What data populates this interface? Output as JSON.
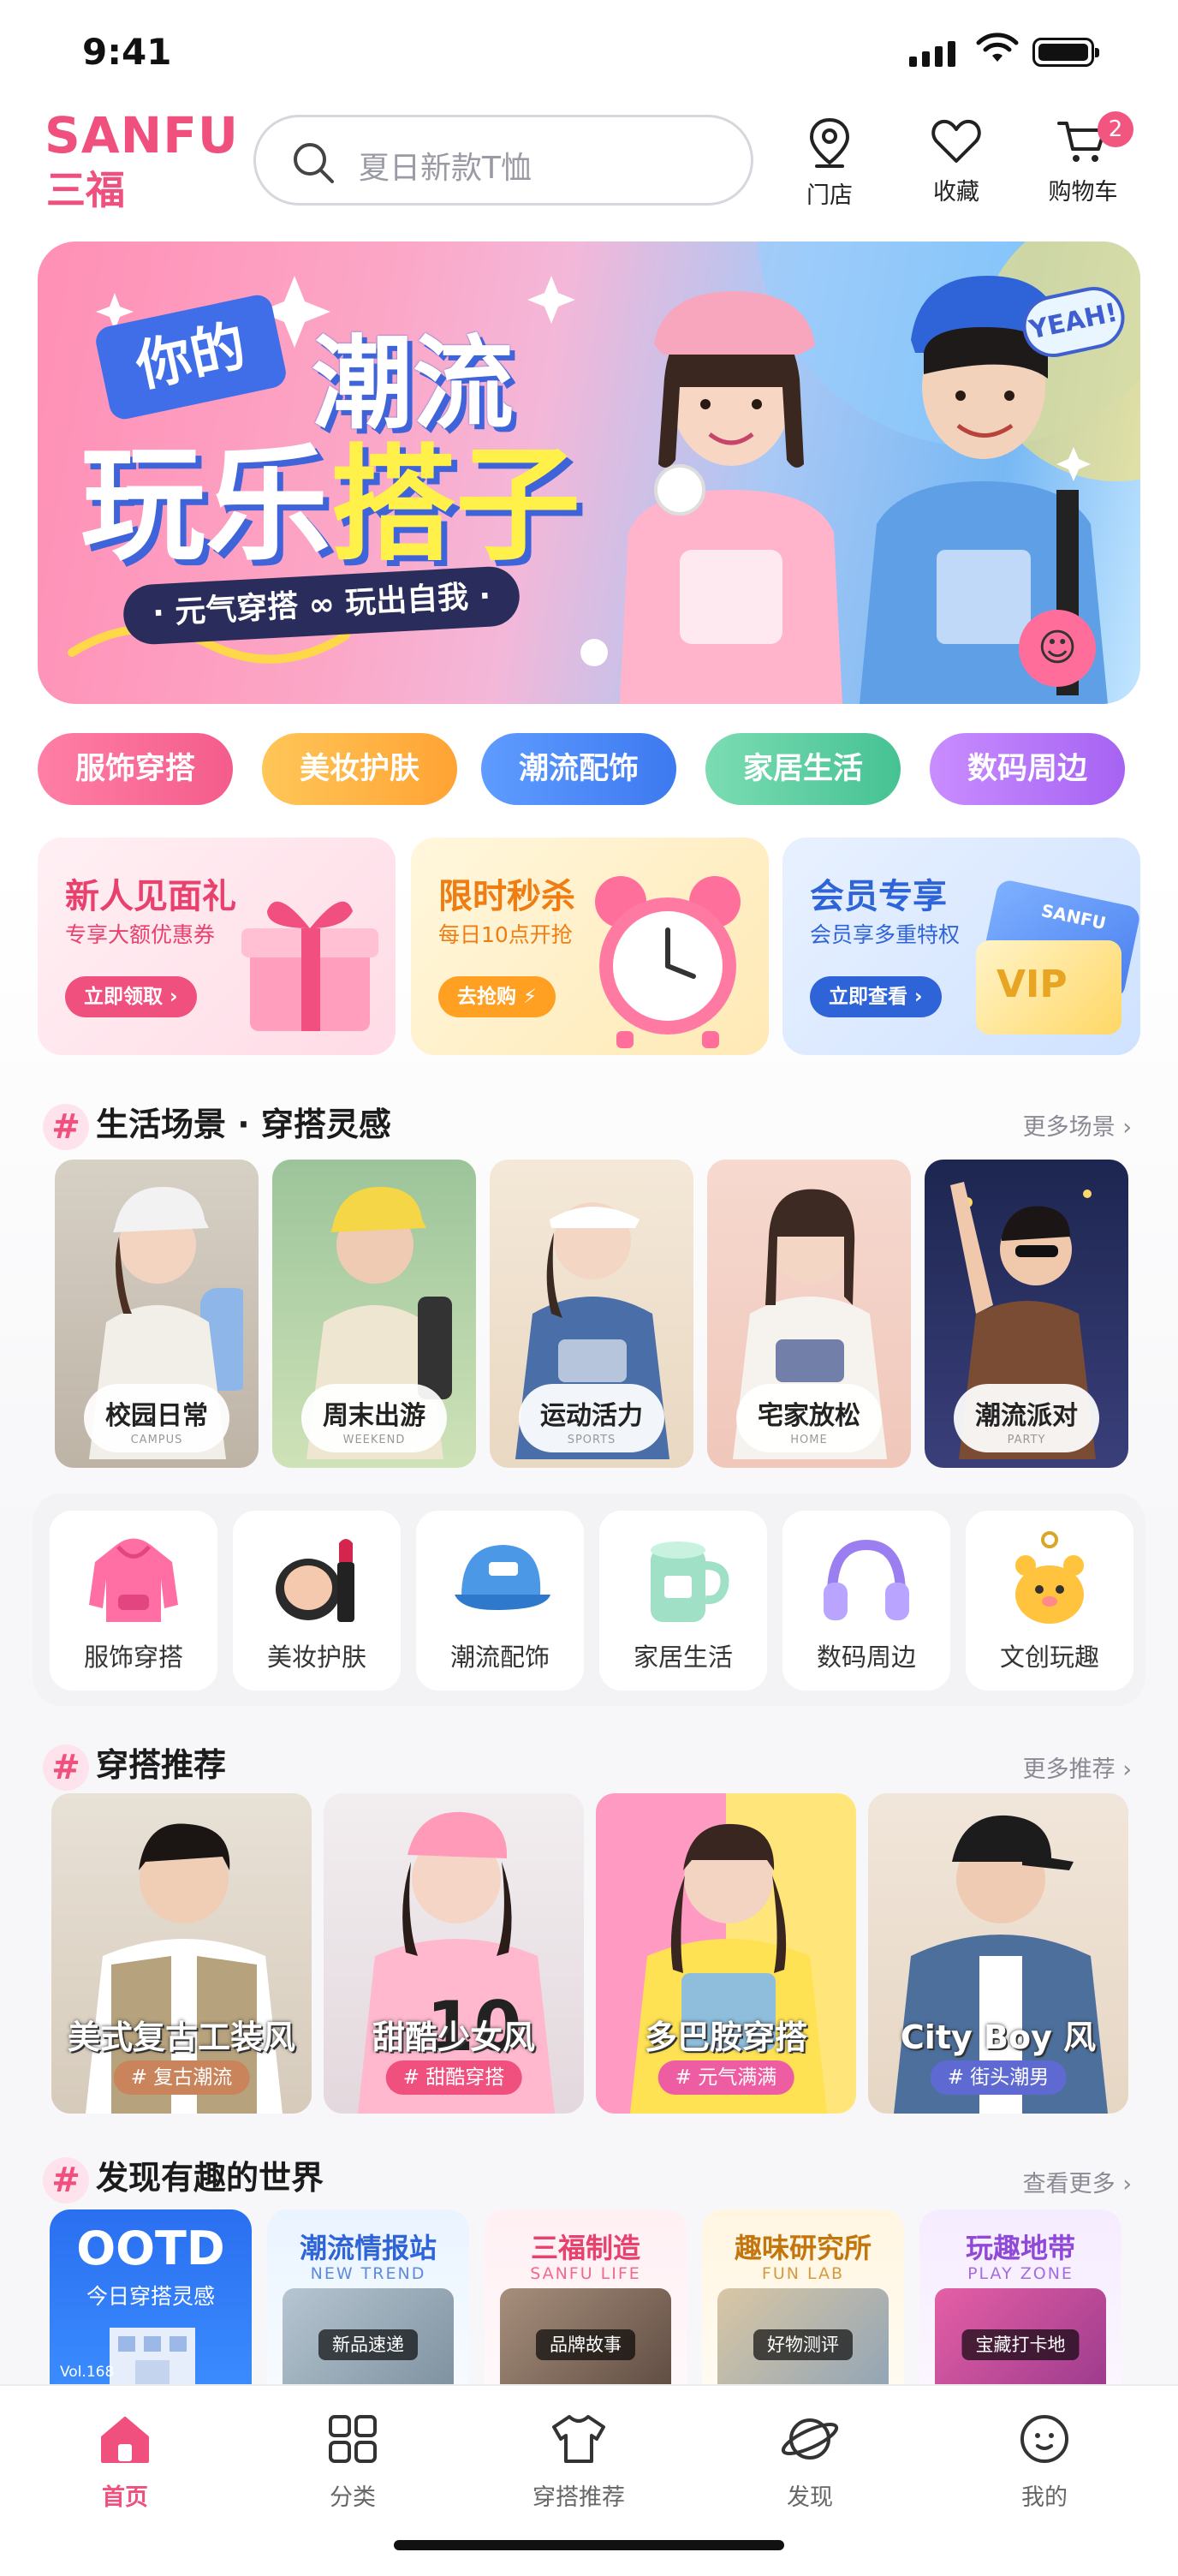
{
  "status": {
    "time": "9:41"
  },
  "brand": {
    "name_en": "SANFU",
    "name_cn": "三福"
  },
  "search": {
    "placeholder": "夏日新款T恤"
  },
  "header_actions": [
    {
      "label": "门店",
      "icon": "store-location-icon"
    },
    {
      "label": "收藏",
      "icon": "heart-icon"
    },
    {
      "label": "购物车",
      "icon": "cart-icon",
      "badge": "2"
    }
  ],
  "banner": {
    "tag": "你的",
    "line1": "潮流",
    "line2a": "玩乐",
    "line2b": "搭子",
    "subtitle": "· 元气穿搭 ∞ 玩出自我 ·",
    "bubble": "YEAH!"
  },
  "chips": [
    "服饰穿搭",
    "美妆护肤",
    "潮流配饰",
    "家居生活",
    "数码周边"
  ],
  "promos": [
    {
      "title": "新人见面礼",
      "subtitle": "专享大额优惠券",
      "button": "立即领取 ›",
      "icon": "gift-box-icon"
    },
    {
      "title": "限时秒杀",
      "subtitle": "每日10点开抢",
      "button": "去抢购 ⚡",
      "icon": "alarm-clock-icon"
    },
    {
      "title": "会员专享",
      "subtitle": "会员享多重特权",
      "button": "立即查看 ›",
      "icon": "vip-card-icon",
      "card_text": "SANFU",
      "card_vip": "VIP"
    }
  ],
  "scenes_section": {
    "title": "生活场景 · 穿搭灵感",
    "more": "更多场景 ›"
  },
  "scenes": [
    {
      "label": "校园日常",
      "en": "CAMPUS"
    },
    {
      "label": "周末出游",
      "en": "WEEKEND"
    },
    {
      "label": "运动活力",
      "en": "SPORTS"
    },
    {
      "label": "宅家放松",
      "en": "HOME"
    },
    {
      "label": "潮流派对",
      "en": "PARTY"
    }
  ],
  "categories": [
    {
      "label": "服饰穿搭",
      "icon": "hoodie-icon"
    },
    {
      "label": "美妆护肤",
      "icon": "cosmetics-icon"
    },
    {
      "label": "潮流配饰",
      "icon": "cap-icon"
    },
    {
      "label": "家居生活",
      "icon": "mug-icon"
    },
    {
      "label": "数码周边",
      "icon": "headphones-icon"
    },
    {
      "label": "文创玩趣",
      "icon": "plush-toy-icon"
    }
  ],
  "outfits_section": {
    "title": "穿搭推荐",
    "more": "更多推荐 ›"
  },
  "outfits": [
    {
      "title": "美式复古工装风",
      "tag": "# 复古潮流"
    },
    {
      "title": "甜酷少女风",
      "tag": "# 甜酷穿搭"
    },
    {
      "title": "多巴胺穿搭",
      "tag": "# 元气满满"
    },
    {
      "title": "City Boy 风",
      "tag": "# 街头潮男"
    }
  ],
  "discover_section": {
    "title": "发现有趣的世界",
    "more": "查看更多 ›"
  },
  "discover": [
    {
      "title": "OOTD",
      "subtitle": "今日穿搭灵感",
      "vol": "Vol.168"
    },
    {
      "title": "潮流情报站",
      "subtitle": "NEW TREND",
      "caption": "新品速递"
    },
    {
      "title": "三福制造",
      "subtitle": "SANFU LIFE",
      "caption": "品牌故事"
    },
    {
      "title": "趣味研究所",
      "subtitle": "FUN LAB",
      "caption": "好物测评"
    },
    {
      "title": "玩趣地带",
      "subtitle": "PLAY ZONE",
      "caption": "宝藏打卡地"
    }
  ],
  "tabs": [
    {
      "label": "首页",
      "icon": "home-icon",
      "active": true
    },
    {
      "label": "分类",
      "icon": "grid-icon"
    },
    {
      "label": "穿搭推荐",
      "icon": "tshirt-icon"
    },
    {
      "label": "发现",
      "icon": "planet-icon"
    },
    {
      "label": "我的",
      "icon": "face-icon"
    }
  ],
  "colors": {
    "brand": "#f0507e",
    "accent_blue": "#3f6ee8"
  }
}
